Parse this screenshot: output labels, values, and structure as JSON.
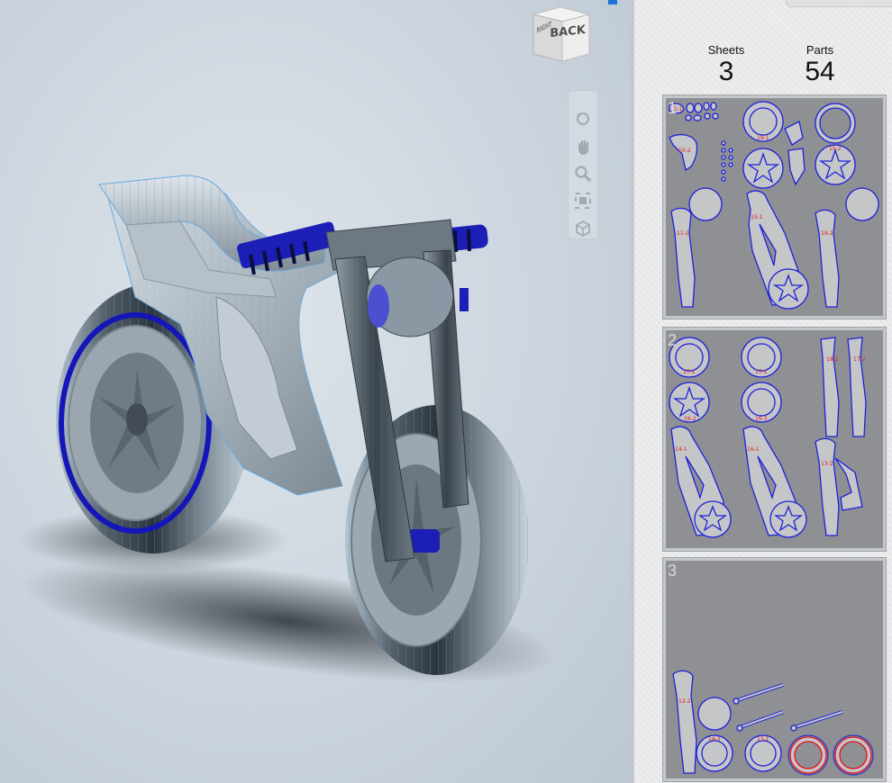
{
  "viewport": {
    "view_cube": {
      "label": "BACK",
      "side_label": "RIGHT"
    },
    "nav_tools": [
      {
        "name": "orbit",
        "icon": "orbit-icon"
      },
      {
        "name": "pan",
        "icon": "pan-hand-icon"
      },
      {
        "name": "zoom",
        "icon": "zoom-magnifier-icon"
      },
      {
        "name": "fit",
        "icon": "zoom-fit-icon"
      },
      {
        "name": "look",
        "icon": "look-at-icon"
      }
    ]
  },
  "panel": {
    "stats": {
      "sheets_label": "Sheets",
      "sheets_value": "3",
      "parts_label": "Parts",
      "parts_value": "54"
    },
    "sheets": [
      {
        "number": "1",
        "part_labels": [
          "11-1",
          "10-2",
          "19-1",
          "15-2",
          "11-2",
          "15-1",
          "19-2"
        ]
      },
      {
        "number": "2",
        "part_labels": [
          "17-1",
          "17-1",
          "18-2",
          "17-2",
          "16-2",
          "16-3",
          "14-1",
          "16-1",
          "13-2"
        ]
      },
      {
        "number": "3",
        "part_labels": [
          "12-2",
          "14-3",
          "13-1"
        ]
      }
    ]
  },
  "colors": {
    "accent_blue": "#1e22d8",
    "label_red": "#e31a1a",
    "sheet_gray": "#8e9093",
    "panel_bg": "#ecedee"
  }
}
